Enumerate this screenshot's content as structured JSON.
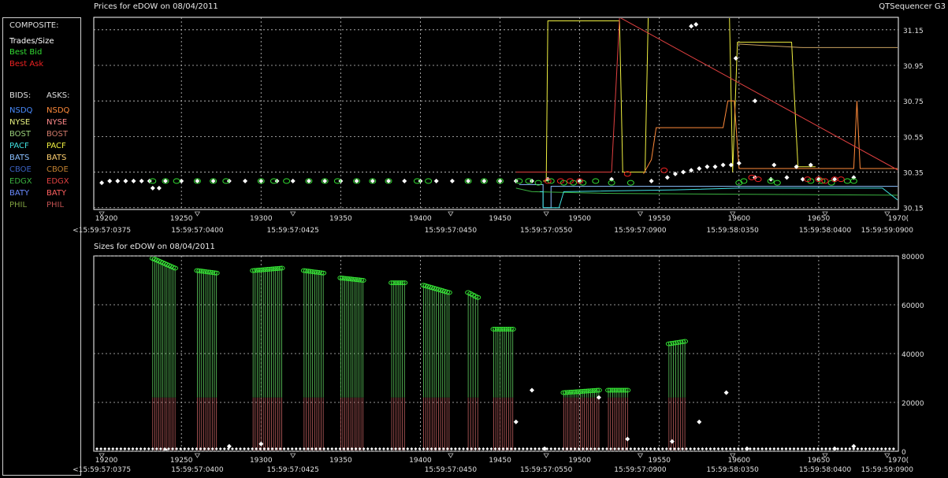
{
  "price_title": "Prices for  eDOW  on  08/04/2011",
  "app_name": "QTSequencer G3",
  "size_title": "Sizes for  eDOW  on  08/04/2011",
  "legend": {
    "composite_header": "COMPOSITE:",
    "trades": "Trades/Size",
    "best_bid": "Best Bid",
    "best_ask": "Best Ask",
    "bids_header": "BIDS:",
    "asks_header": "ASKS:",
    "exchanges": [
      {
        "bid": "NSDQ",
        "ask": "NSDQ",
        "bid_color": "#4a8cff",
        "ask_color": "#ff8a3a"
      },
      {
        "bid": "NYSE",
        "ask": "NYSE",
        "bid_color": "#e8f080",
        "ask_color": "#ff8a8a"
      },
      {
        "bid": "BOST",
        "ask": "BOST",
        "bid_color": "#9ad07a",
        "ask_color": "#d07a6a"
      },
      {
        "bid": "PACF",
        "ask": "PACF",
        "bid_color": "#40e0e0",
        "ask_color": "#f0f040"
      },
      {
        "bid": "BATS",
        "ask": "BATS",
        "bid_color": "#8ac0ff",
        "ask_color": "#ffd070"
      },
      {
        "bid": "CBOE",
        "ask": "CBOE",
        "bid_color": "#3a60c0",
        "ask_color": "#c08030"
      },
      {
        "bid": "EDGX",
        "ask": "EDGX",
        "bid_color": "#3ab040",
        "ask_color": "#e04040"
      },
      {
        "bid": "BATY",
        "ask": "BATY",
        "bid_color": "#6a8aff",
        "ask_color": "#ff6060"
      },
      {
        "bid": "PHIL",
        "ask": "PHIL",
        "bid_color": "#80a040",
        "ask_color": "#c05050"
      }
    ]
  },
  "colors": {
    "trade": "#ffffff",
    "best_bid": "#33dd33",
    "best_ask": "#ee2222",
    "grid": "#c8c8c8",
    "axis": "#ffffff"
  },
  "chart_data": [
    {
      "type": "line",
      "title": "Prices for  eDOW  on  08/04/2011",
      "xlim": [
        19195,
        19700
      ],
      "ylim": [
        30.14,
        31.22
      ],
      "x_ticks": [
        19200,
        19250,
        19300,
        19350,
        19400,
        19450,
        19500,
        19550,
        19600,
        19650,
        19700
      ],
      "x_tick_labels": [
        "19200",
        "19250",
        "19300",
        "19350",
        "19400",
        "19450",
        "19500",
        "19550",
        "19600",
        "19650",
        "1970("
      ],
      "time_labels": [
        {
          "x": 19200,
          "label": "<15:59:57:0375"
        },
        {
          "x": 19260,
          "label": "15:59:57:0400"
        },
        {
          "x": 19320,
          "label": "15:59:57:0425"
        },
        {
          "x": 19419,
          "label": "15:59:57:0450"
        },
        {
          "x": 19479,
          "label": "15:59:57:0550"
        },
        {
          "x": 19538,
          "label": "15:59:57:0900"
        },
        {
          "x": 19596,
          "label": "15:59:58:0350"
        },
        {
          "x": 19654,
          "label": "15:59:58:0400"
        },
        {
          "x": 19693,
          "label": "15:59:59:0900"
        }
      ],
      "y_ticks": [
        30.15,
        30.35,
        30.55,
        30.75,
        30.95,
        31.15
      ],
      "y_tick_labels": [
        "30.15",
        "30.35",
        "30.55",
        "30.75",
        "30.95",
        "31.15"
      ],
      "series": [
        {
          "name": "Trades/Size",
          "color": "#ffffff",
          "style": "markers",
          "x": [
            19200,
            19205,
            19210,
            19215,
            19220,
            19225,
            19230,
            19232,
            19236,
            19240,
            19250,
            19260,
            19270,
            19280,
            19290,
            19300,
            19310,
            19320,
            19330,
            19340,
            19350,
            19360,
            19370,
            19380,
            19390,
            19400,
            19410,
            19420,
            19430,
            19440,
            19450,
            19460,
            19470,
            19480,
            19500,
            19520,
            19545,
            19555,
            19560,
            19565,
            19570,
            19575,
            19580,
            19585,
            19590,
            19595,
            19600,
            19610,
            19620,
            19630,
            19640,
            19650,
            19660,
            19570,
            19573,
            19598,
            19610,
            19622,
            19636,
            19645,
            19672
          ],
          "y": [
            30.29,
            30.3,
            30.3,
            30.3,
            30.3,
            30.3,
            30.3,
            30.26,
            30.26,
            30.3,
            30.3,
            30.3,
            30.3,
            30.3,
            30.3,
            30.3,
            30.3,
            30.3,
            30.3,
            30.3,
            30.3,
            30.3,
            30.3,
            30.3,
            30.3,
            30.3,
            30.3,
            30.3,
            30.3,
            30.3,
            30.3,
            30.3,
            30.3,
            30.31,
            30.3,
            30.31,
            30.3,
            30.32,
            30.34,
            30.35,
            30.36,
            30.37,
            30.38,
            30.38,
            30.39,
            30.39,
            30.4,
            30.32,
            30.31,
            30.32,
            30.31,
            30.31,
            30.31,
            31.17,
            31.18,
            30.99,
            30.75,
            30.39,
            30.38,
            30.39,
            30.32
          ]
        },
        {
          "name": "Best Bid",
          "color": "#33dd33",
          "style": "markers",
          "x": [
            19232,
            19240,
            19247,
            19260,
            19270,
            19278,
            19300,
            19308,
            19316,
            19330,
            19340,
            19348,
            19360,
            19370,
            19380,
            19398,
            19405,
            19430,
            19440,
            19450,
            19462,
            19468,
            19474,
            19482,
            19490,
            19496,
            19502,
            19510,
            19520,
            19532,
            19600,
            19603,
            19620,
            19624,
            19645,
            19652,
            19658,
            19668,
            19672
          ],
          "y": [
            30.3,
            30.3,
            30.3,
            30.3,
            30.3,
            30.3,
            30.3,
            30.3,
            30.3,
            30.3,
            30.3,
            30.3,
            30.3,
            30.3,
            30.3,
            30.3,
            30.3,
            30.3,
            30.3,
            30.3,
            30.3,
            30.3,
            30.29,
            30.3,
            30.29,
            30.29,
            30.29,
            30.3,
            30.29,
            30.29,
            30.29,
            30.3,
            30.3,
            30.29,
            30.3,
            30.3,
            30.29,
            30.3,
            30.3
          ]
        },
        {
          "name": "Best Ask",
          "color": "#ee2222",
          "style": "markers",
          "x": [
            19480,
            19488,
            19494,
            19500,
            19530,
            19553,
            19608,
            19612,
            19643,
            19650,
            19654,
            19660,
            19664
          ],
          "y": [
            30.3,
            30.3,
            30.3,
            30.3,
            30.34,
            30.36,
            30.32,
            30.31,
            30.31,
            30.31,
            30.3,
            30.31,
            30.31
          ]
        },
        {
          "name": "PACF",
          "color": "#f0f040",
          "style": "line",
          "x": [
            19477,
            19479,
            19480,
            19525,
            19527,
            19537,
            19541,
            19543,
            19594,
            19596,
            19599,
            19633,
            19637,
            19643,
            19648
          ],
          "y": [
            30.3,
            30.3,
            31.2,
            31.2,
            30.35,
            30.35,
            30.35,
            31.22,
            31.22,
            30.35,
            31.08,
            31.08,
            30.38,
            30.38,
            30.38
          ]
        },
        {
          "name": "NSDQ",
          "color": "#ff8a3a",
          "style": "line",
          "x": [
            19540,
            19545,
            19548,
            19590,
            19593,
            19597,
            19600,
            19605,
            19607,
            19660,
            19672,
            19674,
            19676,
            19700
          ],
          "y": [
            30.34,
            30.42,
            30.6,
            30.6,
            30.75,
            30.75,
            30.37,
            30.37,
            30.37,
            30.37,
            30.37,
            30.75,
            30.37,
            30.37
          ]
        },
        {
          "name": "NYSE",
          "color": "#c8a060",
          "style": "line",
          "x": [
            19599,
            19640,
            19642,
            19700
          ],
          "y": [
            31.07,
            31.05,
            31.05,
            31.05
          ]
        },
        {
          "name": "BATS",
          "color": "#8ac0ff",
          "style": "line",
          "x": [
            19462,
            19477,
            19477,
            19482,
            19482,
            19700
          ],
          "y": [
            30.28,
            30.28,
            30.15,
            30.15,
            30.27,
            30.27
          ]
        },
        {
          "name": "EDGX",
          "color": "#3ab040",
          "style": "line",
          "x": [
            19460,
            19470,
            19520,
            19700
          ],
          "y": [
            30.26,
            30.24,
            30.23,
            30.22
          ]
        },
        {
          "name": "PACF bid",
          "color": "#40e0e0",
          "style": "line",
          "x": [
            19475,
            19477,
            19477,
            19487,
            19490,
            19560,
            19600,
            19690,
            19700
          ],
          "y": [
            30.24,
            30.24,
            30.15,
            30.15,
            30.24,
            30.25,
            30.26,
            30.26,
            30.19
          ]
        },
        {
          "name": "EDGX ask",
          "color": "#e04040",
          "style": "line",
          "x": [
            19460,
            19520,
            19525,
            19700
          ],
          "y": [
            30.35,
            30.35,
            31.22,
            30.36
          ]
        }
      ]
    },
    {
      "type": "bar",
      "title": "Sizes for  eDOW  on  08/04/2011",
      "xlim": [
        19195,
        19700
      ],
      "ylim": [
        0,
        80000
      ],
      "y_ticks": [
        0,
        20000,
        40000,
        60000,
        80000
      ],
      "y_tick_labels": [
        "0",
        "20000",
        "40000",
        "60000",
        "80000"
      ],
      "bid_groups": [
        {
          "x_start": 19232,
          "x_end": 19246,
          "start": 79000,
          "end": 75000
        },
        {
          "x_start": 19260,
          "x_end": 19272,
          "start": 74000,
          "end": 73000
        },
        {
          "x_start": 19295,
          "x_end": 19313,
          "start": 74000,
          "end": 75000
        },
        {
          "x_start": 19327,
          "x_end": 19339,
          "start": 74000,
          "end": 73000
        },
        {
          "x_start": 19350,
          "x_end": 19364,
          "start": 71000,
          "end": 70000
        },
        {
          "x_start": 19382,
          "x_end": 19390,
          "start": 69000,
          "end": 69000
        },
        {
          "x_start": 19402,
          "x_end": 19418,
          "start": 68000,
          "end": 65000
        },
        {
          "x_start": 19430,
          "x_end": 19436,
          "start": 65000,
          "end": 63000
        },
        {
          "x_start": 19446,
          "x_end": 19458,
          "start": 50000,
          "end": 50000
        },
        {
          "x_start": 19490,
          "x_end": 19512,
          "start": 24000,
          "end": 25000
        },
        {
          "x_start": 19518,
          "x_end": 19530,
          "start": 25000,
          "end": 25000
        },
        {
          "x_start": 19556,
          "x_end": 19566,
          "start": 44000,
          "end": 45000
        }
      ],
      "ask_height": 22000,
      "trades": {
        "x": [
          19240,
          19280,
          19300,
          19460,
          19470,
          19478,
          19512,
          19530,
          19558,
          19575,
          19592,
          19605,
          19660,
          19672
        ],
        "y": [
          500,
          2000,
          3000,
          12000,
          25000,
          1000,
          22000,
          5000,
          4000,
          12000,
          24000,
          1000,
          1000,
          2000
        ]
      }
    }
  ]
}
